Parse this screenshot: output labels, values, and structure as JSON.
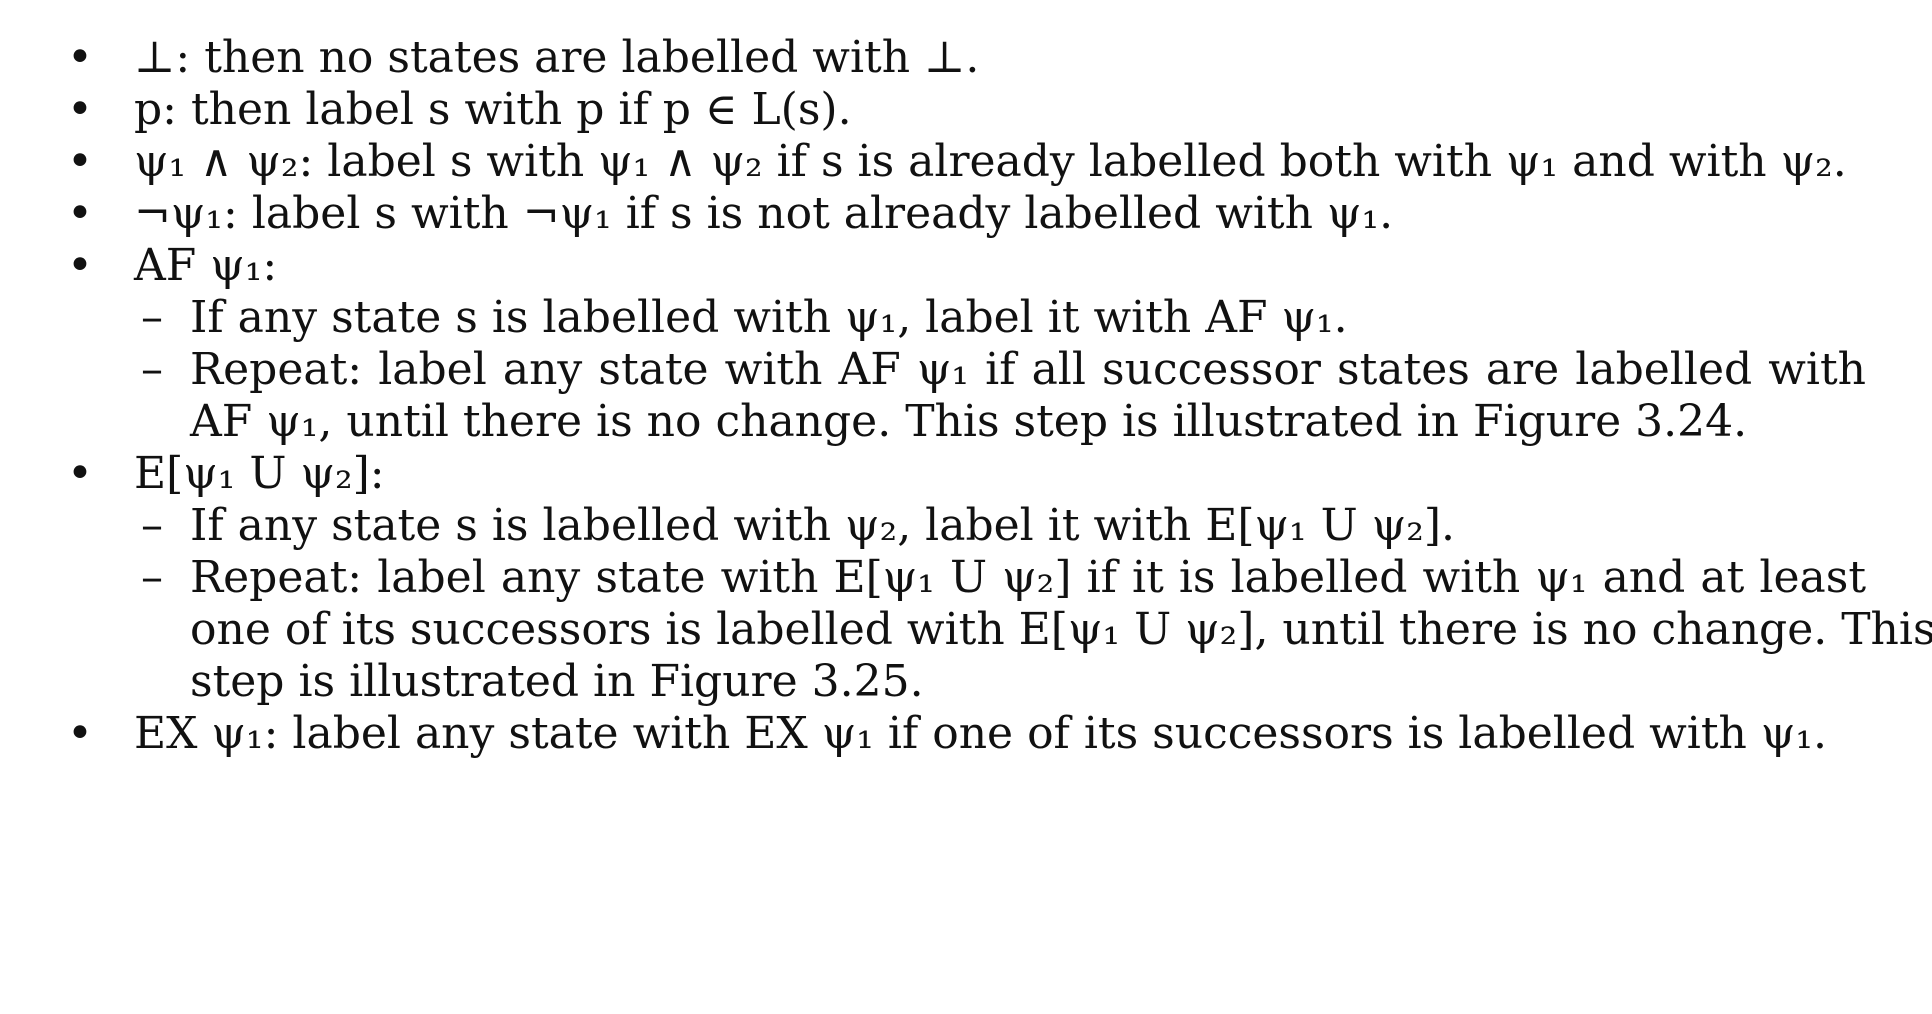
{
  "bullets": {
    "l1": "⊥: then no states are labelled with ⊥.",
    "l2": "p: then label s with p if p ∈ L(s).",
    "l3": "ψ₁ ∧ ψ₂: label s with ψ₁ ∧ ψ₂ if s is already labelled both with ψ₁ and with ψ₂.",
    "l4": "¬ψ₁: label s with ¬ψ₁ if s is not already labelled with ψ₁.",
    "l5": "AF ψ₁:",
    "l5a": "If any state s is labelled with ψ₁, label it with AF ψ₁.",
    "l5b1": "Repeat: label any state with AF ψ₁ if all successor states are labelled with",
    "l5b2": "AF ψ₁, until there is no change. This step is illustrated in Figure 3.24.",
    "l6": "E[ψ₁ U ψ₂]:",
    "l6a": "If any state s is labelled with ψ₂, label it with E[ψ₁ U ψ₂].",
    "l6b1": "Repeat: label any state with E[ψ₁ U ψ₂] if it is labelled with ψ₁ and at least",
    "l6b2": "one of its successors is labelled with E[ψ₁ U ψ₂], until there is no change. This",
    "l6b3": "step is illustrated in Figure 3.25.",
    "l7": "EX ψ₁: label any state with EX ψ₁ if one of its successors is labelled with ψ₁."
  },
  "markers": {
    "bullet": "•",
    "dash": "–"
  }
}
